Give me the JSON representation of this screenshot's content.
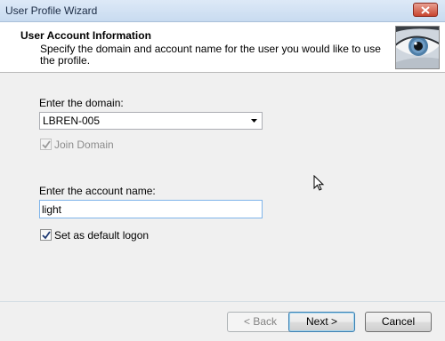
{
  "window": {
    "title": "User Profile Wizard"
  },
  "header": {
    "title": "User Account Information",
    "subtitle": "Specify the domain and account name for the user you would like to use the profile."
  },
  "domain": {
    "label": "Enter the domain:",
    "value": "LBREN-005",
    "join_label": "Join Domain",
    "join_checked": true
  },
  "account": {
    "label": "Enter the account name:",
    "value": "light",
    "default_label": "Set as default logon",
    "default_checked": true
  },
  "buttons": {
    "back": "< Back",
    "next": "Next >",
    "cancel": "Cancel"
  }
}
